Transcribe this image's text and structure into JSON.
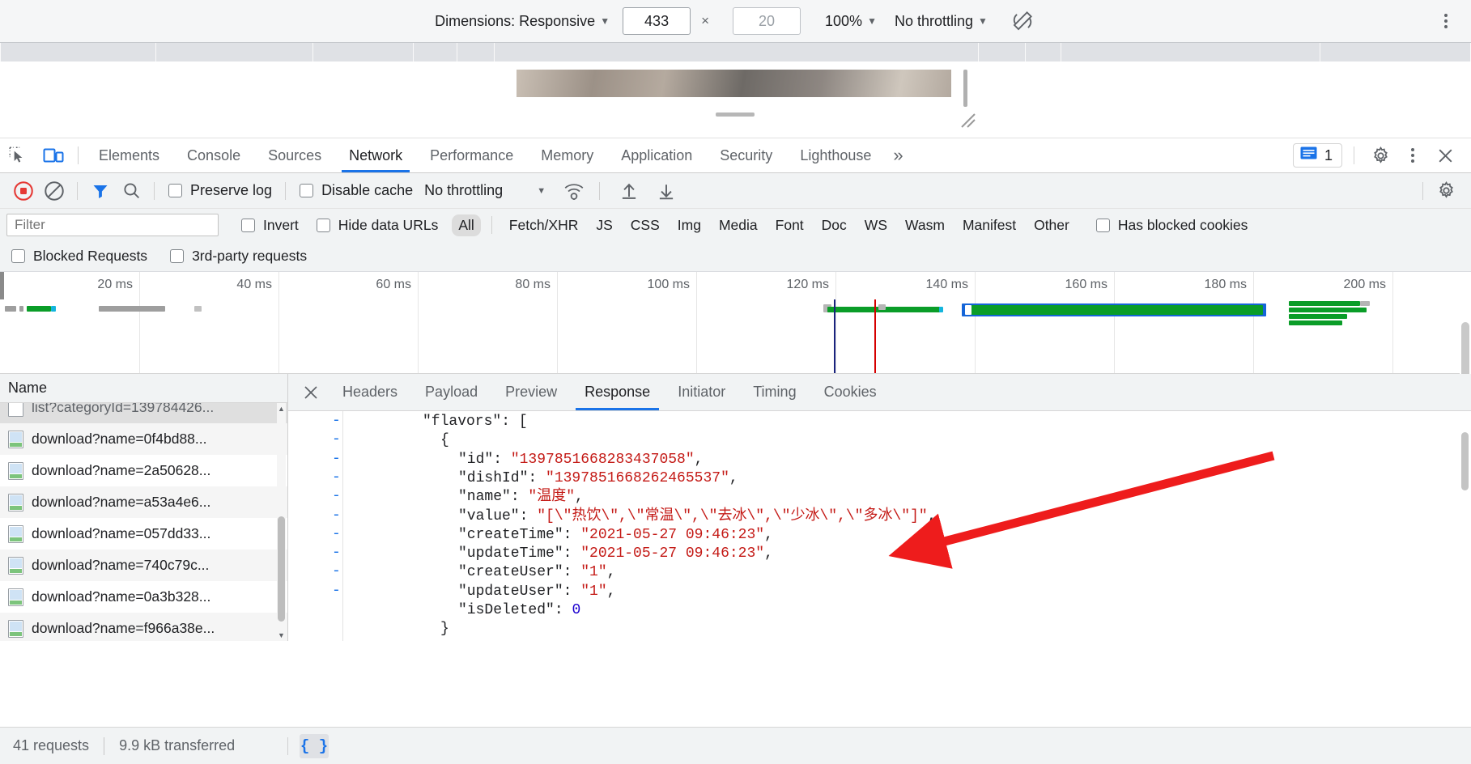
{
  "device_toolbar": {
    "dimensions_label": "Dimensions: Responsive",
    "width_value": "433",
    "times": "×",
    "height_value": "20",
    "zoom_label": "100%",
    "throttling_label": "No throttling",
    "rotate_icon": "rotate-device-icon",
    "more_icon": "kebab-menu-icon"
  },
  "devtools_tabs": {
    "inspect_icon": "inspect-element-icon",
    "device_icon": "toggle-device-toolbar-icon",
    "items": [
      {
        "label": "Elements",
        "active": false
      },
      {
        "label": "Console",
        "active": false
      },
      {
        "label": "Sources",
        "active": false
      },
      {
        "label": "Network",
        "active": true
      },
      {
        "label": "Performance",
        "active": false
      },
      {
        "label": "Memory",
        "active": false
      },
      {
        "label": "Application",
        "active": false
      },
      {
        "label": "Security",
        "active": false
      },
      {
        "label": "Lighthouse",
        "active": false
      }
    ],
    "more_tabs_label": "»",
    "issues_count": "1",
    "issues_icon": "issues-message-icon",
    "settings_icon": "gear-icon",
    "kebab_icon": "kebab-menu-icon",
    "close_icon": "close-icon"
  },
  "network_toolbar": {
    "record_icon": "record-stop-icon",
    "clear_icon": "clear-icon",
    "filter_icon": "funnel-filter-icon",
    "search_icon": "search-icon",
    "preserve_log_label": "Preserve log",
    "disable_cache_label": "Disable cache",
    "throttling_value": "No throttling",
    "wifi_icon": "network-conditions-icon",
    "import_icon": "import-har-icon",
    "export_icon": "export-har-icon",
    "settings_icon": "gear-icon"
  },
  "filter_bar": {
    "filter_placeholder": "Filter",
    "filter_value": "",
    "invert_label": "Invert",
    "hide_data_urls_label": "Hide data URLs",
    "types": [
      {
        "label": "All",
        "selected": true
      },
      {
        "label": "Fetch/XHR",
        "selected": false
      },
      {
        "label": "JS",
        "selected": false
      },
      {
        "label": "CSS",
        "selected": false
      },
      {
        "label": "Img",
        "selected": false
      },
      {
        "label": "Media",
        "selected": false
      },
      {
        "label": "Font",
        "selected": false
      },
      {
        "label": "Doc",
        "selected": false
      },
      {
        "label": "WS",
        "selected": false
      },
      {
        "label": "Wasm",
        "selected": false
      },
      {
        "label": "Manifest",
        "selected": false
      },
      {
        "label": "Other",
        "selected": false
      }
    ],
    "has_blocked_cookies_label": "Has blocked cookies",
    "blocked_requests_label": "Blocked Requests",
    "third_party_requests_label": "3rd-party requests"
  },
  "overview": {
    "ticks": [
      "20 ms",
      "40 ms",
      "60 ms",
      "80 ms",
      "100 ms",
      "120 ms",
      "140 ms",
      "160 ms",
      "180 ms",
      "200 ms"
    ]
  },
  "request_list": {
    "column_header": "Name",
    "rows": [
      {
        "name": "list?categoryId=139784426...",
        "selected": true,
        "icon": "document-file-icon"
      },
      {
        "name": "download?name=0f4bd88...",
        "selected": false,
        "icon": "image-file-icon"
      },
      {
        "name": "download?name=2a50628...",
        "selected": false,
        "icon": "image-file-icon"
      },
      {
        "name": "download?name=a53a4e6...",
        "selected": false,
        "icon": "image-file-icon"
      },
      {
        "name": "download?name=057dd33...",
        "selected": false,
        "icon": "image-file-icon"
      },
      {
        "name": "download?name=740c79c...",
        "selected": false,
        "icon": "image-file-icon"
      },
      {
        "name": "download?name=0a3b328...",
        "selected": false,
        "icon": "image-file-icon"
      },
      {
        "name": "download?name=f966a38e...",
        "selected": false,
        "icon": "image-file-icon"
      }
    ]
  },
  "response_panel": {
    "close_icon": "close-icon",
    "tabs": [
      {
        "label": "Headers",
        "active": false
      },
      {
        "label": "Payload",
        "active": false
      },
      {
        "label": "Preview",
        "active": false
      },
      {
        "label": "Response",
        "active": true
      },
      {
        "label": "Initiator",
        "active": false
      },
      {
        "label": "Timing",
        "active": false
      },
      {
        "label": "Cookies",
        "active": false
      }
    ],
    "json_lines": [
      {
        "fold": "-",
        "indent": 8,
        "tokens": [
          {
            "t": "\"flavors\"",
            "c": "k"
          },
          {
            "t": ": [",
            "c": "p"
          }
        ]
      },
      {
        "fold": "-",
        "indent": 10,
        "tokens": [
          {
            "t": "{",
            "c": "p"
          }
        ]
      },
      {
        "fold": "-",
        "indent": 12,
        "tokens": [
          {
            "t": "\"id\"",
            "c": "k"
          },
          {
            "t": ": ",
            "c": "p"
          },
          {
            "t": "\"1397851668283437058\"",
            "c": "s"
          },
          {
            "t": ",",
            "c": "p"
          }
        ]
      },
      {
        "fold": "-",
        "indent": 12,
        "tokens": [
          {
            "t": "\"dishId\"",
            "c": "k"
          },
          {
            "t": ": ",
            "c": "p"
          },
          {
            "t": "\"1397851668262465537\"",
            "c": "s"
          },
          {
            "t": ",",
            "c": "p"
          }
        ]
      },
      {
        "fold": "-",
        "indent": 12,
        "tokens": [
          {
            "t": "\"name\"",
            "c": "k"
          },
          {
            "t": ": ",
            "c": "p"
          },
          {
            "t": "\"温度\"",
            "c": "s"
          },
          {
            "t": ",",
            "c": "p"
          }
        ]
      },
      {
        "fold": "-",
        "indent": 12,
        "tokens": [
          {
            "t": "\"value\"",
            "c": "k"
          },
          {
            "t": ": ",
            "c": "p"
          },
          {
            "t": "\"[\\\"热饮\\\",\\\"常温\\\",\\\"去冰\\\",\\\"少冰\\\",\\\"多冰\\\"]\"",
            "c": "s"
          },
          {
            "t": ",",
            "c": "p"
          }
        ]
      },
      {
        "fold": "-",
        "indent": 12,
        "tokens": [
          {
            "t": "\"createTime\"",
            "c": "k"
          },
          {
            "t": ": ",
            "c": "p"
          },
          {
            "t": "\"2021-05-27 09:46:23\"",
            "c": "s"
          },
          {
            "t": ",",
            "c": "p"
          }
        ]
      },
      {
        "fold": "-",
        "indent": 12,
        "tokens": [
          {
            "t": "\"updateTime\"",
            "c": "k"
          },
          {
            "t": ": ",
            "c": "p"
          },
          {
            "t": "\"2021-05-27 09:46:23\"",
            "c": "s"
          },
          {
            "t": ",",
            "c": "p"
          }
        ]
      },
      {
        "fold": "-",
        "indent": 12,
        "tokens": [
          {
            "t": "\"createUser\"",
            "c": "k"
          },
          {
            "t": ": ",
            "c": "p"
          },
          {
            "t": "\"1\"",
            "c": "s"
          },
          {
            "t": ",",
            "c": "p"
          }
        ]
      },
      {
        "fold": "-",
        "indent": 12,
        "tokens": [
          {
            "t": "\"updateUser\"",
            "c": "k"
          },
          {
            "t": ": ",
            "c": "p"
          },
          {
            "t": "\"1\"",
            "c": "s"
          },
          {
            "t": ",",
            "c": "p"
          }
        ]
      },
      {
        "fold": "",
        "indent": 12,
        "tokens": [
          {
            "t": "\"isDeleted\"",
            "c": "k"
          },
          {
            "t": ": ",
            "c": "p"
          },
          {
            "t": "0",
            "c": "n"
          }
        ]
      },
      {
        "fold": "",
        "indent": 10,
        "tokens": [
          {
            "t": "}",
            "c": "p"
          }
        ]
      }
    ]
  },
  "status_bar": {
    "requests_text": "41 requests",
    "transferred_text": "9.9 kB transferred",
    "format_icon": "pretty-print-braces-icon",
    "format_label": "{ }"
  },
  "colors": {
    "accent": "#1a73e8",
    "record_red": "#e53935",
    "string_red": "#c41a16",
    "number_blue": "#1c00cf",
    "annotation_arrow": "#ee1c1c",
    "waterfall_green": "#0a9d28",
    "waterfall_blue": "#1565d8",
    "toolbar_bg": "#f1f3f4"
  }
}
